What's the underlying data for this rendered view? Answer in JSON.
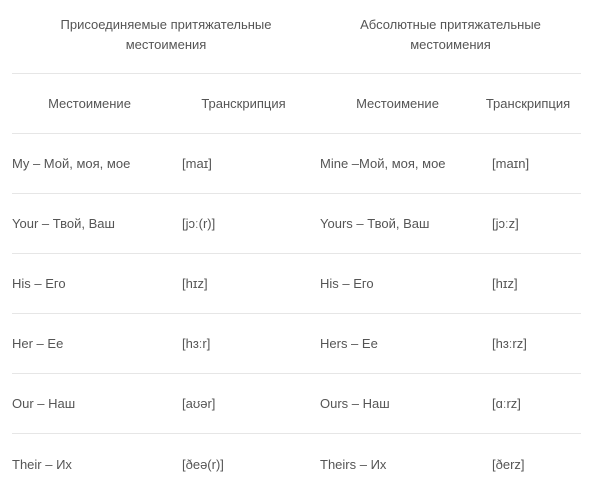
{
  "headers": {
    "group1": "Присоединяемые притяжательные местоимения",
    "group2": "Абсолютные притяжательные местоимения"
  },
  "subheaders": {
    "pronoun1": "Местоимение",
    "transcription1": "Транскрипция",
    "pronoun2": "Местоимение",
    "transcription2": "Транскрипция"
  },
  "rows": [
    {
      "p1": "My – Мой, моя, мое",
      "t1": "[maɪ]",
      "p2": "Mine –Мой, моя, мое",
      "t2": "[maɪn]"
    },
    {
      "p1": "Your –  Твой, Ваш",
      "t1": "[jɔː(r)]",
      "p2": "Yours – Твой, Ваш",
      "t2": "[jɔːz]"
    },
    {
      "p1": "His –  Его",
      "t1": "[hɪz]",
      "p2": "His – Его",
      "t2": "[hɪz]"
    },
    {
      "p1": "Her – Ее",
      "t1": "[hɜːr]",
      "p2": "Hers – Ее",
      "t2": "[hɜːrz]"
    },
    {
      "p1": "Our – Наш",
      "t1": "[aʊər]",
      "p2": "Ours – Наш",
      "t2": "[ɑːrz]"
    },
    {
      "p1": "Their – Их",
      "t1": "[ðeə(r)]",
      "p2": "Theirs – Их",
      "t2": "[ðerz]"
    }
  ]
}
